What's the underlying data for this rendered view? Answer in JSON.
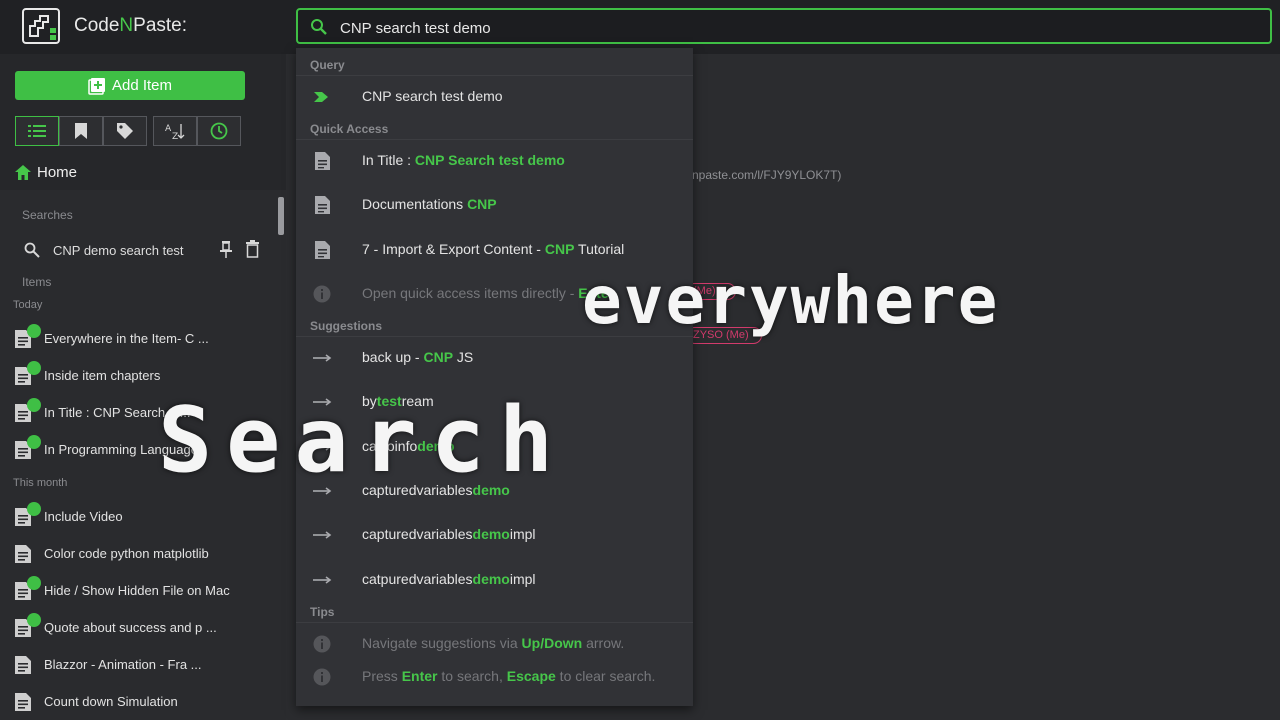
{
  "app": {
    "title_main": "Code",
    "title_accent": "N",
    "title_rest": "Paste:"
  },
  "search": {
    "value": "CNP search test demo"
  },
  "sidebar": {
    "add_item_label": "Add Item",
    "home_label": "Home",
    "searches_label": "Searches",
    "saved_search": "CNP demo search test",
    "items_label": "Items",
    "today_label": "Today",
    "month_label": "This month",
    "items": [
      "Everywhere in the Item- C ...",
      "Inside item chapters",
      "In Title : CNP Search te...",
      "In Programming Language",
      "Include Video",
      "Color code python matplotlib",
      "Hide / Show Hidden File on Mac",
      "Quote about success and p ...",
      "Blazzor - Animation - Fra ...",
      "Count down Simulation"
    ]
  },
  "background": {
    "url_fragment": "npaste.com/l/FJY9YLOK7T)",
    "pill1": "ZYSO (Me)",
    "pill2": "(Me)"
  },
  "dropdown": {
    "query_head": "Query",
    "query_text": "CNP search test demo",
    "quick_head": "Quick Access",
    "qa1_prefix": "In Title : ",
    "qa1_hl": "CNP Search test demo",
    "qa2_prefix": "Documentations ",
    "qa2_hl": "CNP",
    "qa3_prefix": "7 - Import & Export Content - ",
    "qa3_hl": "CNP",
    "qa3_suffix": " Tutorial",
    "qa_info_prefix": "Open quick access items directly - ",
    "qa_info_hl": "Enter",
    "sugg_head": "Suggestions",
    "s1_prefix": "back up - ",
    "s1_hl": "CNP",
    "s1_suffix": " JS",
    "s2_prefix": "by",
    "s2_hl": "test",
    "s2_suffix": "ream",
    "s3_prefix": "calltoinfo",
    "s3_hl": "demo",
    "s4_prefix": "capturedvariables",
    "s4_hl": "demo",
    "s5_prefix": "capturedvariables",
    "s5_hl": "demo",
    "s5_suffix": "impl",
    "s6_prefix": "catpuredvariables",
    "s6_hl": "demo",
    "s6_suffix": "impl",
    "tips_head": "Tips",
    "tip1_prefix": "Navigate suggestions via ",
    "tip1_hl": "Up/Down",
    "tip1_suffix": " arrow.",
    "tip2_a": "Press ",
    "tip2_hl1": "Enter",
    "tip2_b": " to search, ",
    "tip2_hl2": "Escape",
    "tip2_c": " to clear search."
  },
  "overlay": {
    "word1": "everywhere",
    "word2": "Search"
  },
  "colors": {
    "accent": "#3fbf45",
    "pill": "#d23b6c"
  }
}
